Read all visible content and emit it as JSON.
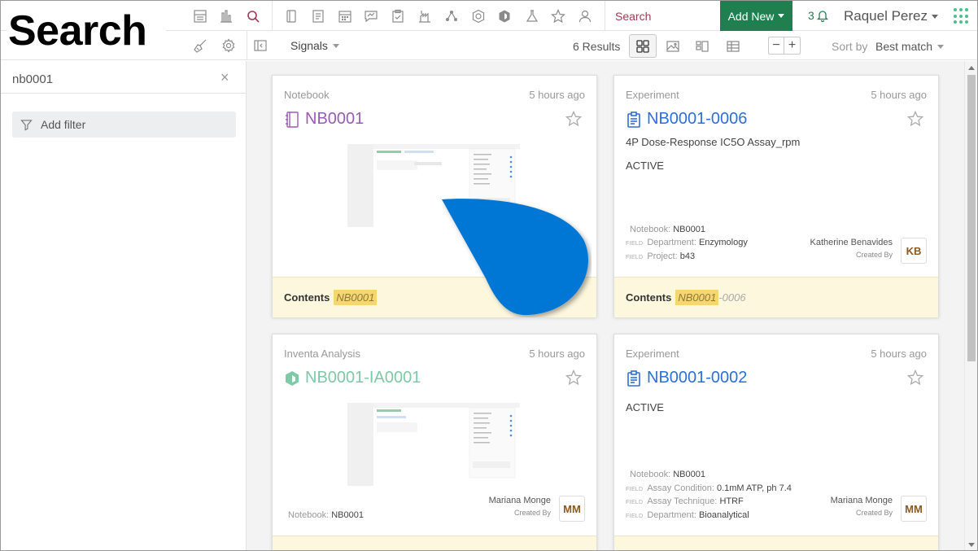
{
  "overlay_title": "Search",
  "topbar": {
    "icons": [
      "dashboard-icon",
      "chart-icon",
      "search-icon",
      "notebook-icon",
      "document-icon",
      "calendar-icon",
      "chat-icon",
      "clipboard-icon",
      "lab-icon",
      "network-icon",
      "hexagon-icon",
      "inventa-icon",
      "flask-icon",
      "star-icon",
      "user-icon"
    ],
    "search_label": "Search",
    "add_new_label": "Add New",
    "notification_count": "3",
    "user_name": "Raquel Perez"
  },
  "subbar": {
    "signals_label": "Signals",
    "results_label": "6 Results",
    "sort_label": "Sort by",
    "sort_value": "Best match"
  },
  "left": {
    "search_value": "nb0001",
    "clear_symbol": "×",
    "add_filter_label": "Add filter"
  },
  "colors": {
    "accent_green": "#1f7f4f",
    "notebook_purple": "#9a5bb8",
    "experiment_blue": "#2d6fd8",
    "inventa_teal": "#7fc9a8",
    "highlight": "#f7d670",
    "drop_blue": "#0277d4"
  },
  "cards": [
    {
      "type": "Notebook",
      "time": "5 hours ago",
      "title": "NB0001",
      "footer_label": "Contents",
      "footer_highlight": "NB0001",
      "footer_rest": ""
    },
    {
      "type": "Experiment",
      "time": "5 hours ago",
      "title": "NB0001-0006",
      "desc": "4P Dose-Response IC5O Assay_rpm",
      "status": "ACTIVE",
      "meta": [
        {
          "tag": "",
          "key": "Notebook:",
          "value": "NB0001"
        },
        {
          "tag": "FIELD",
          "key": "Department:",
          "value": "Enzymology"
        },
        {
          "tag": "FIELD",
          "key": "Project:",
          "value": "b43"
        }
      ],
      "creator": "Katherine Benavides",
      "created_by": "Created By",
      "initials": "KB",
      "footer_label": "Contents",
      "footer_highlight": "NB0001",
      "footer_rest": "-0006"
    },
    {
      "type": "Inventa Analysis",
      "time": "5 hours ago",
      "title": "NB0001-IA0001",
      "meta": [
        {
          "tag": "",
          "key": "Notebook:",
          "value": "NB0001"
        }
      ],
      "creator": "Mariana Monge",
      "created_by": "Created By",
      "initials": "MM"
    },
    {
      "type": "Experiment",
      "time": "5 hours ago",
      "title": "NB0001-0002",
      "status": "ACTIVE",
      "meta": [
        {
          "tag": "",
          "key": "Notebook:",
          "value": "NB0001"
        },
        {
          "tag": "FIELD",
          "key": "Assay Condition:",
          "value": "0.1mM ATP, ph 7.4"
        },
        {
          "tag": "FIELD",
          "key": "Assay Technique:",
          "value": "HTRF"
        },
        {
          "tag": "FIELD",
          "key": "Department:",
          "value": "Bioanalytical"
        }
      ],
      "creator": "Mariana Monge",
      "created_by": "Created By",
      "initials": "MM"
    }
  ]
}
